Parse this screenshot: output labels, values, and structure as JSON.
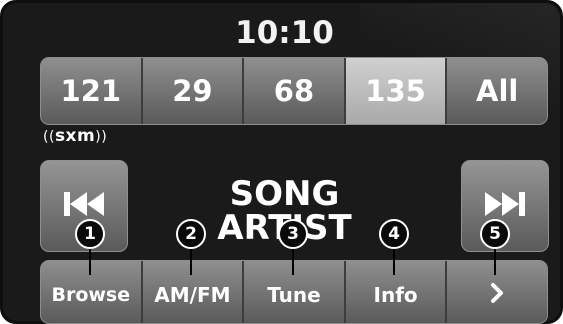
{
  "clock": "10:10",
  "presets": [
    {
      "label": "121",
      "active": false
    },
    {
      "label": "29",
      "active": false
    },
    {
      "label": "68",
      "active": false
    },
    {
      "label": "135",
      "active": true
    },
    {
      "label": "All",
      "active": false
    }
  ],
  "brand": {
    "logo_text": "sxm",
    "left_waves": "((·",
    "right_waves": "))"
  },
  "seek": {
    "prev_icon": "seek-back-icon",
    "next_icon": "seek-forward-icon"
  },
  "now_playing": {
    "song": "SONG",
    "artist": "ARTIST"
  },
  "bottom_tabs": [
    {
      "label": "Browse",
      "callout": "1"
    },
    {
      "label": "AM/FM",
      "callout": "2"
    },
    {
      "label": "Tune",
      "callout": "3"
    },
    {
      "label": "Info",
      "callout": "4"
    },
    {
      "label": "›",
      "callout": "5",
      "icon": "chevron-right-icon"
    }
  ],
  "colors": {
    "background": "#1a1a1a",
    "button_gradient_top": "#8f8f8f",
    "button_gradient_bottom": "#5a5a5a",
    "active_preset": "#c0c0c0",
    "text": "#ffffff"
  }
}
